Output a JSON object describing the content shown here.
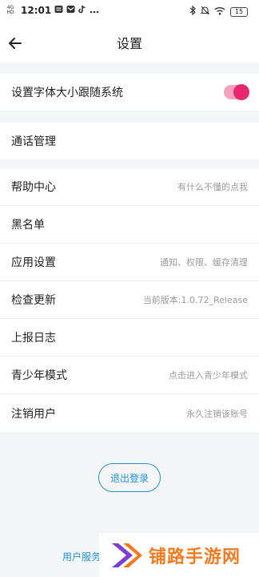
{
  "status_bar": {
    "network": "4G",
    "network_sub": "HD",
    "time": "12:01",
    "battery": "15"
  },
  "header": {
    "title": "设置"
  },
  "font_follow": {
    "label": "设置字体大小跟随系统",
    "enabled": true
  },
  "call_manage": {
    "label": "通话管理"
  },
  "settings": [
    {
      "label": "帮助中心",
      "hint": "有什么不懂的点我"
    },
    {
      "label": "黑名单",
      "hint": ""
    },
    {
      "label": "应用设置",
      "hint": "通知、权限、缓存清理"
    },
    {
      "label": "检查更新",
      "hint": "当前版本:1.0.72_Release"
    },
    {
      "label": "上报日志",
      "hint": ""
    },
    {
      "label": "青少年模式",
      "hint": "点击进入青少年模式"
    },
    {
      "label": "注销用户",
      "hint": "永久注销该账号"
    }
  ],
  "logout_label": "退出登录",
  "footer": {
    "link": "用户服务"
  },
  "watermark": {
    "text": "铺路手游网"
  },
  "colors": {
    "accent_blue": "#2592d8",
    "toggle_on": "#e8286e",
    "watermark_orange": "#f47a20",
    "watermark_purple": "#7b3fd6"
  }
}
